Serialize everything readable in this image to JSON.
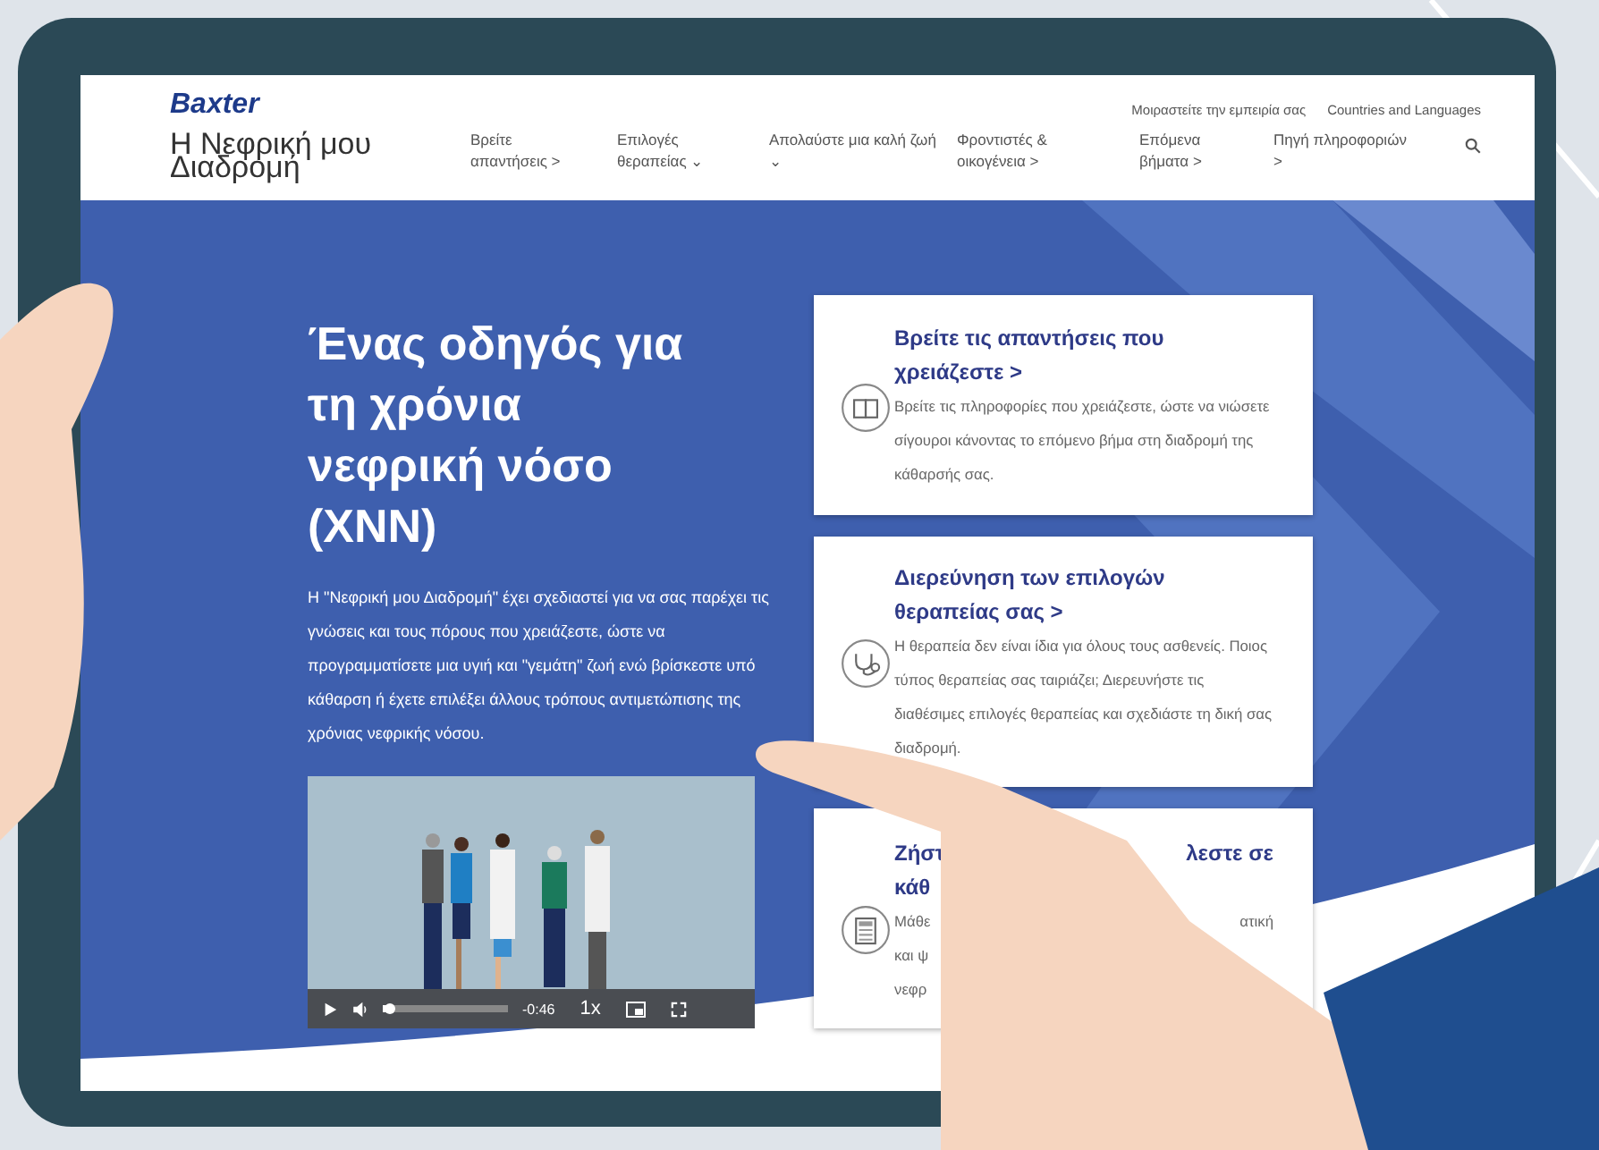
{
  "header": {
    "logo": "Baxter",
    "site_title": "Η Νεφρική μου Διαδρομή",
    "top_links": [
      "Μοιραστείτε την εμπειρία σας",
      "Countries and Languages"
    ],
    "nav": [
      {
        "label": "Βρείτε απαντήσεις >"
      },
      {
        "label": "Επιλογές θεραπείας ⌄"
      },
      {
        "label": "Απολαύστε μια καλή ζωή ⌄"
      },
      {
        "label": "Φροντιστές & οικογένεια >"
      },
      {
        "label": "Επόμενα βήματα >"
      },
      {
        "label": "Πηγή πληροφοριών >"
      }
    ]
  },
  "hero": {
    "title": "Ένας οδηγός για τη χρόνια νεφρική νόσο (ΧΝΝ)",
    "text": "Η \"Νεφρική μου Διαδρομή\" έχει σχεδιαστεί για να σας παρέχει τις γνώσεις και τους πόρους που χρειάζεστε, ώστε να προγραμματίσετε μια υγιή και \"γεμάτη\" ζωή ενώ βρίσκεστε υπό κάθαρση ή έχετε επιλέξει άλλους τρόπους αντιμετώπισης της χρόνιας νεφρικής νόσου.",
    "video": {
      "progress": {
        "level": 0.05
      },
      "time": "-0:46",
      "speed": "1x"
    }
  },
  "cards": [
    {
      "kind": "full",
      "title": "Βρείτε τις απαντήσεις που χρειάζεστε >",
      "text": "Βρείτε τις πληροφορίες που χρειάζεστε, ώστε να νιώσετε σίγουροι κάνοντας το επόμενο βήμα στη διαδρομή της κάθαρσής σας."
    },
    {
      "kind": "full",
      "title": "Διερεύνηση των επιλογών θεραπείας σας >",
      "text": "Η θεραπεία δεν είναι ίδια για όλους τους ασθενείς. Ποιος τύπος θεραπείας σας ταιριάζει; Διερευνήστε τις διαθέσιμες επιλογές θεραπείας και σχεδιάστε τη δική σας διαδρομή."
    },
    {
      "kind": "covered",
      "title_rows": [
        [
          "Ζήστ",
          "λεστε σε"
        ],
        [
          "κάθ"
        ]
      ],
      "text_rows": [
        [
          "Μάθε",
          "ατική"
        ],
        [
          "και ψ"
        ],
        [
          "νεφρ"
        ]
      ]
    }
  ]
}
